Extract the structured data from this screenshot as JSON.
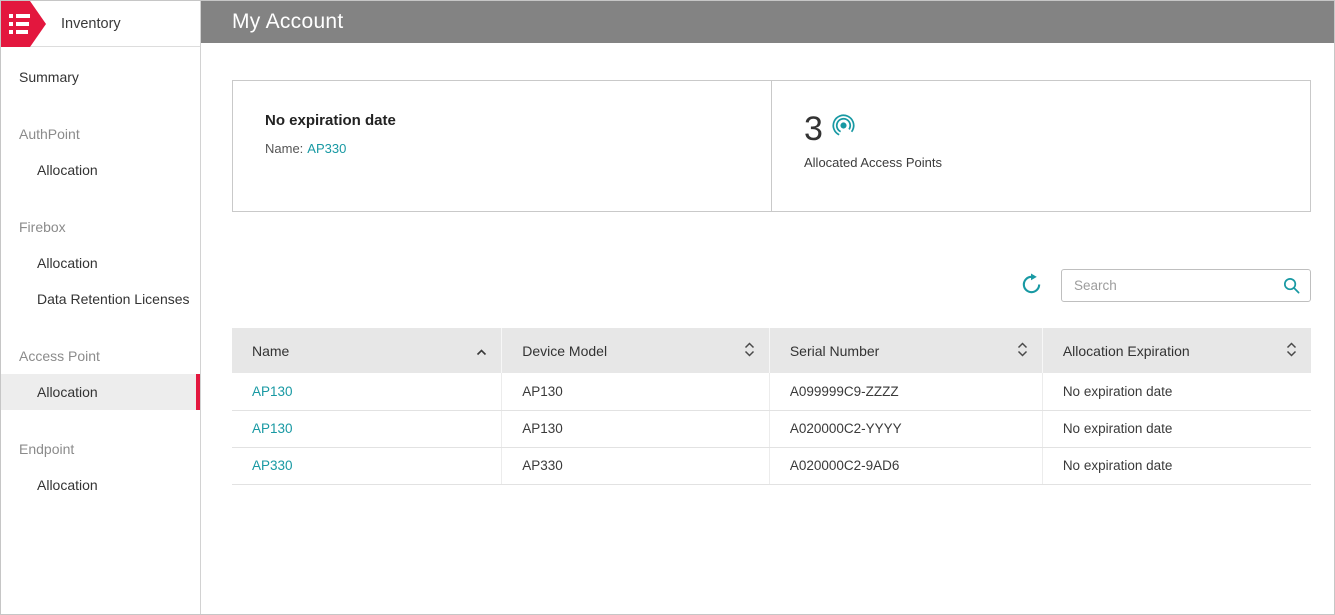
{
  "colors": {
    "accent_teal": "#1899A3",
    "brand_red": "#E3173E",
    "topbar_gray": "#838383",
    "table_header_gray": "#E7E7E7",
    "selected_item_bg": "#EDEDED"
  },
  "sidebar": {
    "brand": "Inventory",
    "items": [
      {
        "label": "Summary",
        "type": "item",
        "selected": false
      },
      {
        "label": "AuthPoint",
        "type": "section"
      },
      {
        "label": "Allocation",
        "type": "subitem",
        "selected": false
      },
      {
        "label": "Firebox",
        "type": "section"
      },
      {
        "label": "Allocation",
        "type": "subitem",
        "selected": false
      },
      {
        "label": "Data Retention Licenses",
        "type": "subitem",
        "selected": false
      },
      {
        "label": "Access Point",
        "type": "section"
      },
      {
        "label": "Allocation",
        "type": "subitem",
        "selected": true
      },
      {
        "label": "Endpoint",
        "type": "section"
      },
      {
        "label": "Allocation",
        "type": "subitem",
        "selected": false
      }
    ]
  },
  "header": {
    "title": "My Account"
  },
  "cards": {
    "expiration": {
      "title": "No expiration date",
      "name_label": "Name:",
      "name_value": "AP330"
    },
    "allocated": {
      "count": "3",
      "label": "Allocated Access Points",
      "icon": "access-point-icon"
    }
  },
  "toolbar": {
    "search_placeholder": "Search",
    "refresh_icon": "refresh-icon",
    "search_icon": "magnifier-icon"
  },
  "table": {
    "columns": [
      {
        "label": "Name",
        "sort": "asc"
      },
      {
        "label": "Device Model",
        "sort": "none"
      },
      {
        "label": "Serial Number",
        "sort": "none"
      },
      {
        "label": "Allocation Expiration",
        "sort": "none"
      }
    ],
    "rows": [
      {
        "name": "AP130",
        "device_model": "AP130",
        "serial_number": "A099999C9-ZZZZ",
        "allocation_expiration": "No expiration date"
      },
      {
        "name": "AP130",
        "device_model": "AP130",
        "serial_number": "A020000C2-YYYY",
        "allocation_expiration": "No expiration date"
      },
      {
        "name": "AP330",
        "device_model": "AP330",
        "serial_number": "A020000C2-9AD6",
        "allocation_expiration": "No expiration date"
      }
    ]
  }
}
